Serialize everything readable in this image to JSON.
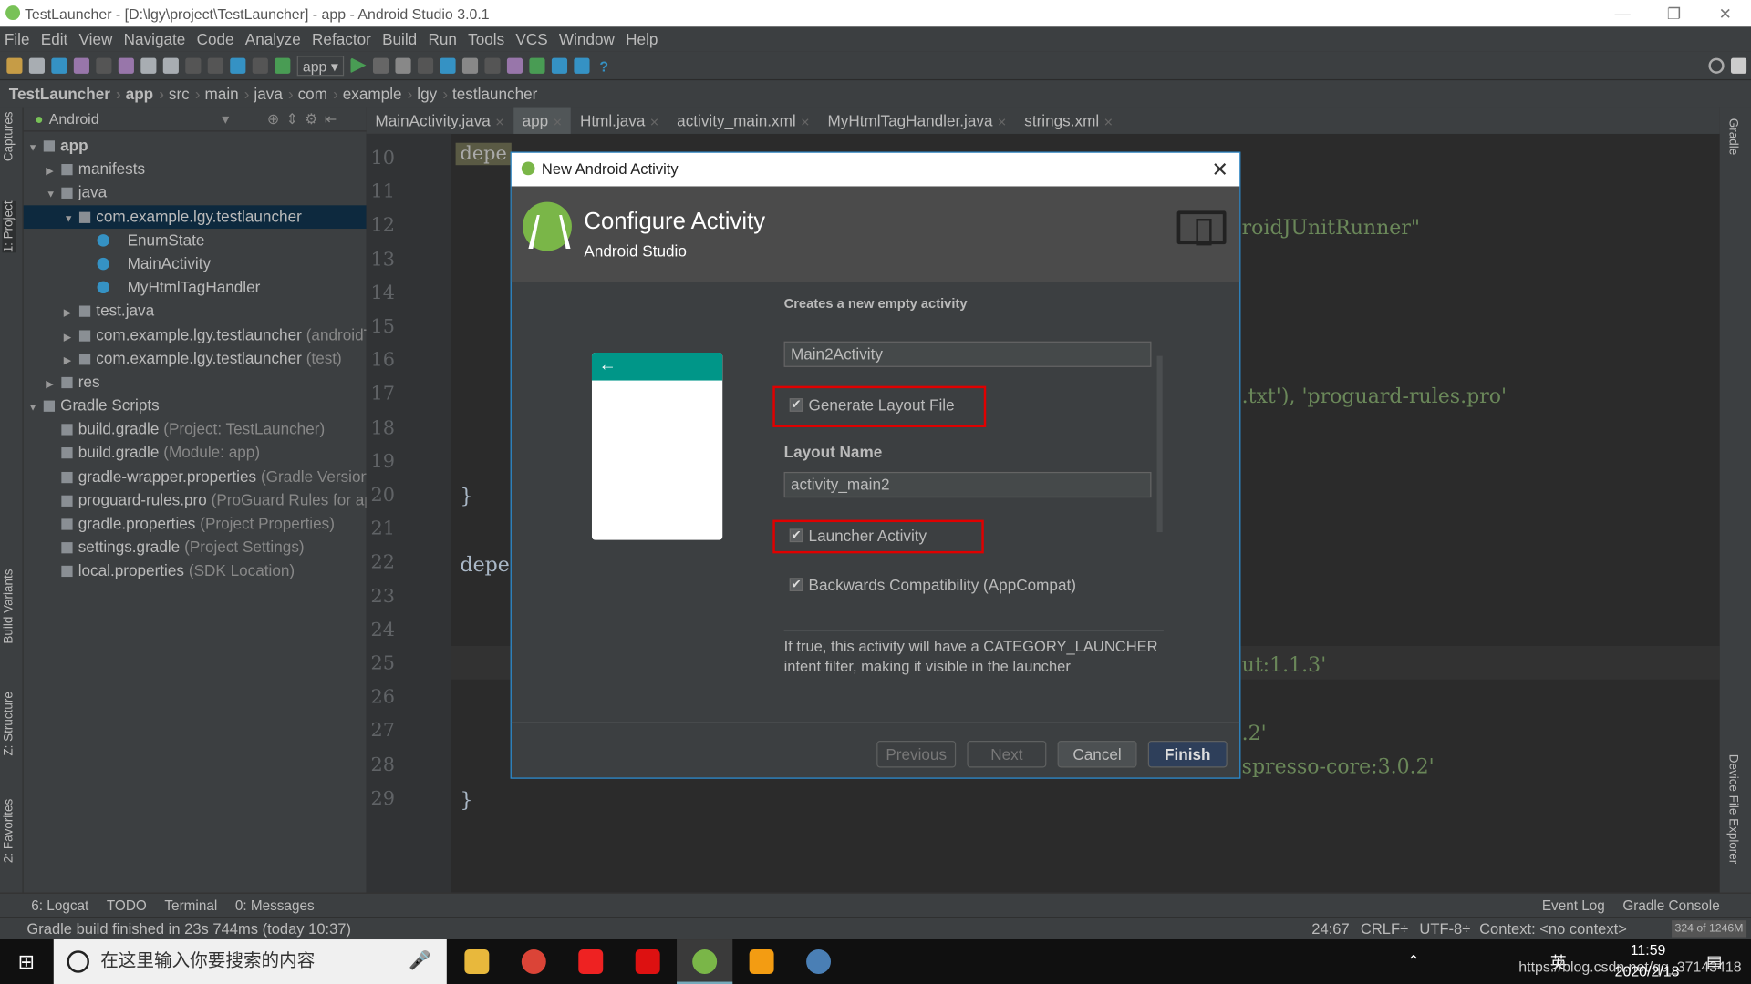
{
  "window": {
    "title": "TestLauncher - [D:\\lgy\\project\\TestLauncher] - app - Android Studio 3.0.1",
    "controls": [
      "—",
      "❐",
      "✕"
    ]
  },
  "menu": [
    "File",
    "Edit",
    "View",
    "Navigate",
    "Code",
    "Analyze",
    "Refactor",
    "Build",
    "Run",
    "Tools",
    "VCS",
    "Window",
    "Help"
  ],
  "toolbar": {
    "run_config": "app ▾"
  },
  "breadcrumbs": [
    "TestLauncher",
    "app",
    "src",
    "main",
    "java",
    "com",
    "example",
    "lgy",
    "testlauncher"
  ],
  "side_tabs": {
    "left": [
      "1: Project",
      "Captures",
      "Build Variants",
      "Z: Structure",
      "2: Favorites"
    ],
    "right": [
      "Gradle",
      "Device File Explorer"
    ]
  },
  "project": {
    "view": "Android",
    "tree": [
      {
        "label": "app",
        "extra": ""
      },
      {
        "label": "manifests",
        "extra": ""
      },
      {
        "label": "java",
        "extra": ""
      },
      {
        "label": "com.example.lgy.testlauncher",
        "extra": ""
      },
      {
        "label": "EnumState",
        "extra": ""
      },
      {
        "label": "MainActivity",
        "extra": ""
      },
      {
        "label": "MyHtmlTagHandler",
        "extra": ""
      },
      {
        "label": "test.java",
        "extra": ""
      },
      {
        "label": "com.example.lgy.testlauncher",
        "extra": "(androidTest)"
      },
      {
        "label": "com.example.lgy.testlauncher",
        "extra": "(test)"
      },
      {
        "label": "res",
        "extra": ""
      },
      {
        "label": "Gradle Scripts",
        "extra": ""
      },
      {
        "label": "build.gradle",
        "extra": "(Project: TestLauncher)"
      },
      {
        "label": "build.gradle",
        "extra": "(Module: app)"
      },
      {
        "label": "gradle-wrapper.properties",
        "extra": "(Gradle Version)"
      },
      {
        "label": "proguard-rules.pro",
        "extra": "(ProGuard Rules for app)"
      },
      {
        "label": "gradle.properties",
        "extra": "(Project Properties)"
      },
      {
        "label": "settings.gradle",
        "extra": "(Project Settings)"
      },
      {
        "label": "local.properties",
        "extra": "(SDK Location)"
      }
    ]
  },
  "editor": {
    "tabs": [
      "MainActivity.java",
      "app",
      "Html.java",
      "activity_main.xml",
      "MyHtmlTagHandler.java",
      "strings.xml"
    ],
    "active_tab": 1,
    "line_numbers": [
      "10",
      "11",
      "12",
      "13",
      "14",
      "15",
      "16",
      "17",
      "18",
      "19",
      "20",
      "21",
      "22",
      "23",
      "24",
      "25",
      "26",
      "27",
      "28",
      "29"
    ],
    "code_fragments": [
      "depe",
      "roidJUnitRunner\"",
      ".txt'),  'proguard-rules.pro'",
      "}",
      "depe",
      "ut:1.1.3'",
      ".2'",
      "spresso-core:3.0.2'",
      "}"
    ]
  },
  "dialog": {
    "title": "New Android Activity",
    "heading": "Configure Activity",
    "subheading": "Android Studio",
    "description": "Creates a new empty activity",
    "activity_name": "Main2Activity",
    "generate_layout": {
      "label": "Generate Layout File",
      "checked": true
    },
    "layout_name_label": "Layout Name",
    "layout_name": "activity_main2",
    "launcher": {
      "label": "Launcher Activity",
      "checked": true
    },
    "appcompat": {
      "label": "Backwards Compatibility (AppCompat)",
      "checked": true
    },
    "help": "If true, this activity will have a CATEGORY_LAUNCHER intent filter, making it visible in the launcher",
    "buttons": {
      "previous": "Previous",
      "next": "Next",
      "cancel": "Cancel",
      "finish": "Finish"
    },
    "check_mark": "✔",
    "back_arrow": "←"
  },
  "bottom_tools": [
    "6: Logcat",
    "TODO",
    "Terminal",
    "0: Messages",
    "Event Log",
    "Gradle Console"
  ],
  "status": {
    "message": "Gradle build finished in 23s 744ms (today 10:37)",
    "position": "24:67",
    "line_sep": "CRLF÷",
    "encoding": "UTF-8÷",
    "context": "Context: <no context>",
    "memory": "324 of 1246M"
  },
  "taskbar": {
    "search_placeholder": "在这里输入你要搜索的内容",
    "time": "11:59",
    "date": "2020/2/18",
    "ime": "英",
    "watermark": "https://blog.csdn.net/qq_37143418"
  }
}
